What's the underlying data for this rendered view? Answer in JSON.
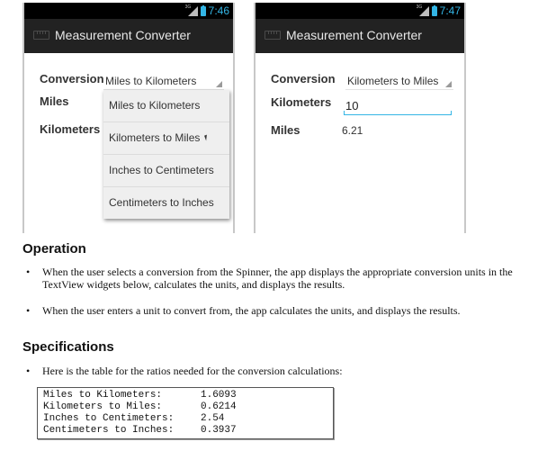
{
  "left_phone": {
    "status_time": "7:46",
    "network": "3G",
    "app_title": "Measurement Converter",
    "conversion_label": "Conversion",
    "spinner_selected": "Miles to Kilometers",
    "from_label": "Miles",
    "to_label": "Kilometers",
    "dropdown_options": [
      "Miles to Kilometers",
      "Kilometers to Miles",
      "Inches to Centimeters",
      "Centimeters to Inches"
    ]
  },
  "right_phone": {
    "status_time": "7:47",
    "network": "3G",
    "app_title": "Measurement Converter",
    "conversion_label": "Conversion",
    "spinner_selected": "Kilometers to Miles",
    "from_label": "Kilometers",
    "from_value": "10",
    "to_label": "Miles",
    "to_value": "6.21"
  },
  "document": {
    "operation_heading": "Operation",
    "operation_bullets": [
      "When the user selects a conversion from the Spinner, the app displays the appropriate conversion units in the TextView widgets below, calculates the units, and displays the results.",
      "When the user enters a unit to convert from, the app calculates the units, and displays the results."
    ],
    "specifications_heading": "Specifications",
    "spec_bullets": [
      "Here is the table for the ratios needed for the conversion calculations:"
    ],
    "ratios": [
      {
        "name": "Miles to Kilometers:",
        "value": "1.6093"
      },
      {
        "name": "Kilometers to Miles:",
        "value": "0.6214"
      },
      {
        "name": "Inches to Centimeters:",
        "value": "2.54"
      },
      {
        "name": "Centimeters to Inches:",
        "value": "0.3937"
      }
    ],
    "bullet_glyph": "•"
  },
  "colors": {
    "accent": "#33b5e5",
    "actionbar": "#222222",
    "statusbar": "#000000"
  }
}
